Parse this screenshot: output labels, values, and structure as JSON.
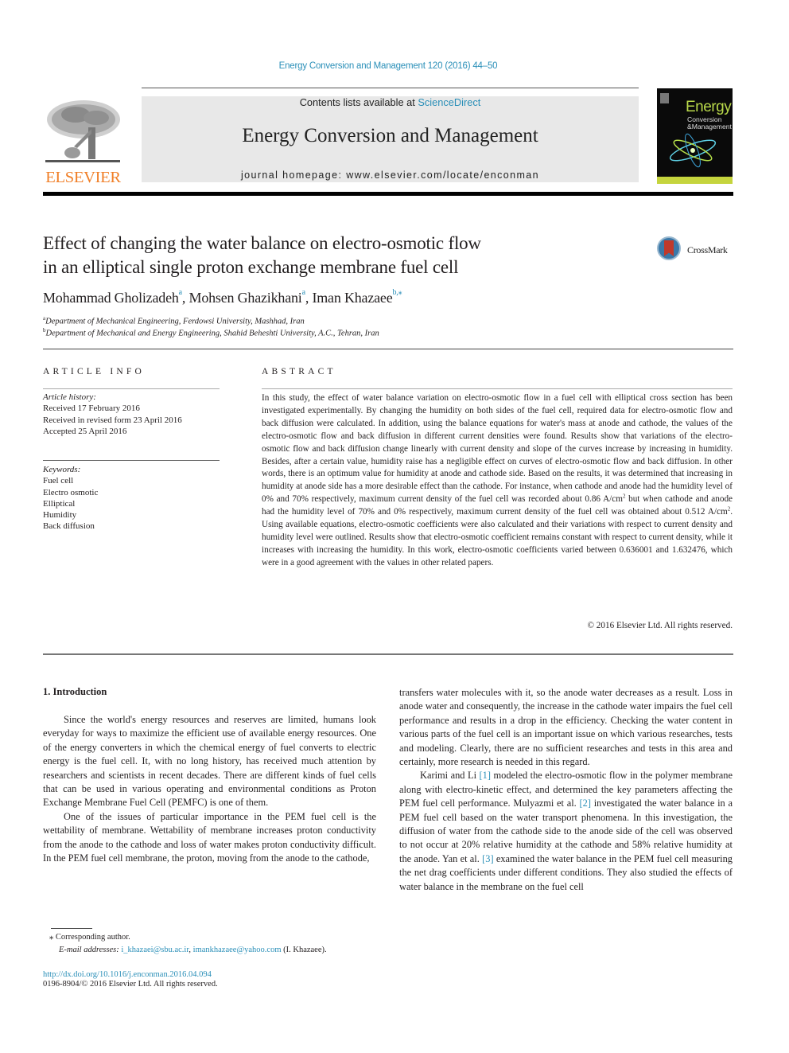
{
  "running_head": "Energy Conversion and Management 120 (2016) 44–50",
  "publisher": {
    "logo_text": "ELSEVIER",
    "logo_color": "#f07e26"
  },
  "masthead": {
    "contents_prefix": "Contents lists available at ",
    "contents_link": "ScienceDirect",
    "journal_title": "Energy Conversion and Management",
    "homepage": "journal homepage: www.elsevier.com/locate/enconman"
  },
  "cover": {
    "title_big": "Energy",
    "title_line2": "Conversion",
    "title_line3": "Management"
  },
  "crossmark_label": "CrossMark",
  "article": {
    "title_line1": "Effect of changing the water balance on electro-osmotic flow",
    "title_line2": "in an elliptical single proton exchange membrane fuel cell",
    "authors": [
      {
        "name": "Mohammad Gholizadeh",
        "sup": "a"
      },
      {
        "name": "Mohsen Ghazikhani",
        "sup": "a"
      },
      {
        "name": "Iman Khazaee",
        "sup": "b,⁎"
      }
    ],
    "affiliations": [
      {
        "sup": "a",
        "text": "Department of Mechanical Engineering, Ferdowsi University, Mashhad, Iran"
      },
      {
        "sup": "b",
        "text": "Department of Mechanical and Energy Engineering, Shahid Beheshti University, A.C., Tehran, Iran"
      }
    ]
  },
  "article_info": {
    "heading": "ARTICLE INFO",
    "history_label": "Article history:",
    "history": [
      "Received 17 February 2016",
      "Received in revised form 23 April 2016",
      "Accepted 25 April 2016"
    ],
    "keywords_label": "Keywords:",
    "keywords": [
      "Fuel cell",
      "Electro osmotic",
      "Elliptical",
      "Humidity",
      "Back diffusion"
    ]
  },
  "abstract": {
    "heading": "ABSTRACT",
    "part1": "In this study, the effect of water balance variation on electro-osmotic flow in a fuel cell with elliptical cross section has been investigated experimentally. By changing the humidity on both sides of the fuel cell, required data for electro-osmotic flow and back diffusion were calculated. In addition, using the balance equations for water's mass at anode and cathode, the values of the electro-osmotic flow and back diffusion in different current densities were found. Results show that variations of the electro-osmotic flow and back diffusion change linearly with current density and slope of the curves increase by increasing in humidity. Besides, after a certain value, humidity raise has a negligible effect on curves of electro-osmotic flow and back diffusion. In other words, there is an optimum value for humidity at anode and cathode side. Based on the results, it was determined that increasing in humidity at anode side has a more desirable effect than the cathode. For instance, when cathode and anode had the humidity level of 0% and 70% respectively, maximum current density of the fuel cell was recorded about 0.86 A/cm",
    "sup1": "2",
    "part2": " but when cathode and anode had the humidity level of 70% and 0% respectively, maximum current density of the fuel cell was obtained about 0.512 A/cm",
    "sup2": "2",
    "part3": ". Using available equations, electro-osmotic coefficients were also calculated and their variations with respect to current density and humidity level were outlined. Results show that electro-osmotic coefficient remains constant with respect to current density, while it increases with increasing the humidity. In this work, electro-osmotic coefficients varied between 0.636001 and 1.632476, which were in a good agreement with the values in other related papers.",
    "copyright": "© 2016 Elsevier Ltd. All rights reserved."
  },
  "body": {
    "section_heading": "1. Introduction",
    "left_paragraphs": [
      "Since the world's energy resources and reserves are limited, humans look everyday for ways to maximize the efficient use of available energy resources. One of the energy converters in which the chemical energy of fuel converts to electric energy is the fuel cell. It, with no long history, has received much attention by researchers and scientists in recent decades. There are different kinds of fuel cells that can be used in various operating and environmental conditions as Proton Exchange Membrane Fuel Cell (PEMFC) is one of them.",
      "One of the issues of particular importance in the PEM fuel cell is the wettability of membrane. Wettability of membrane increases proton conductivity from the anode to the cathode and loss of water makes proton conductivity difficult. In the PEM fuel cell membrane, the proton, moving from the anode to the cathode,"
    ],
    "right_continuation": "transfers water molecules with it, so the anode water decreases as a result. Loss in anode water and consequently, the increase in the cathode water impairs the fuel cell performance and results in a drop in the efficiency. Checking the water content in various parts of the fuel cell is an important issue on which various researches, tests and modeling. Clearly, there are no sufficient researches and tests in this area and certainly, more research is needed in this regard.",
    "right_p2": {
      "a": "Karimi and Li ",
      "ref1": "[1]",
      "b": " modeled the electro-osmotic flow in the polymer membrane along with electro-kinetic effect, and determined the key parameters affecting the PEM fuel cell performance. Mulyazmi et al. ",
      "ref2": "[2]",
      "c": " investigated the water balance in a PEM fuel cell based on the water transport phenomena. In this investigation, the diffusion of water from the cathode side to the anode side of the cell was observed to not occur at 20% relative humidity at the cathode and 58% relative humidity at the anode. Yan et al. ",
      "ref3": "[3]",
      "d": " examined the water balance in the PEM fuel cell measuring the net drag coefficients under different conditions. They also studied the effects of water balance in the membrane on the fuel cell"
    }
  },
  "footnotes": {
    "corresponding": "⁎  Corresponding author.",
    "email_label": "E-mail addresses: ",
    "email1": "i_khazaei@sbu.ac.ir",
    "sep": ", ",
    "email2": "imankhazaee@yahoo.com",
    "email_suffix": " (I. Khazaee).",
    "doi": "http://dx.doi.org/10.1016/j.enconman.2016.04.094",
    "issn": "0196-8904/© 2016 Elsevier Ltd. All rights reserved."
  },
  "colors": {
    "link": "#2a8fb8",
    "elsevier_orange": "#f07e26",
    "masthead_bg": "#e8e8e8"
  }
}
